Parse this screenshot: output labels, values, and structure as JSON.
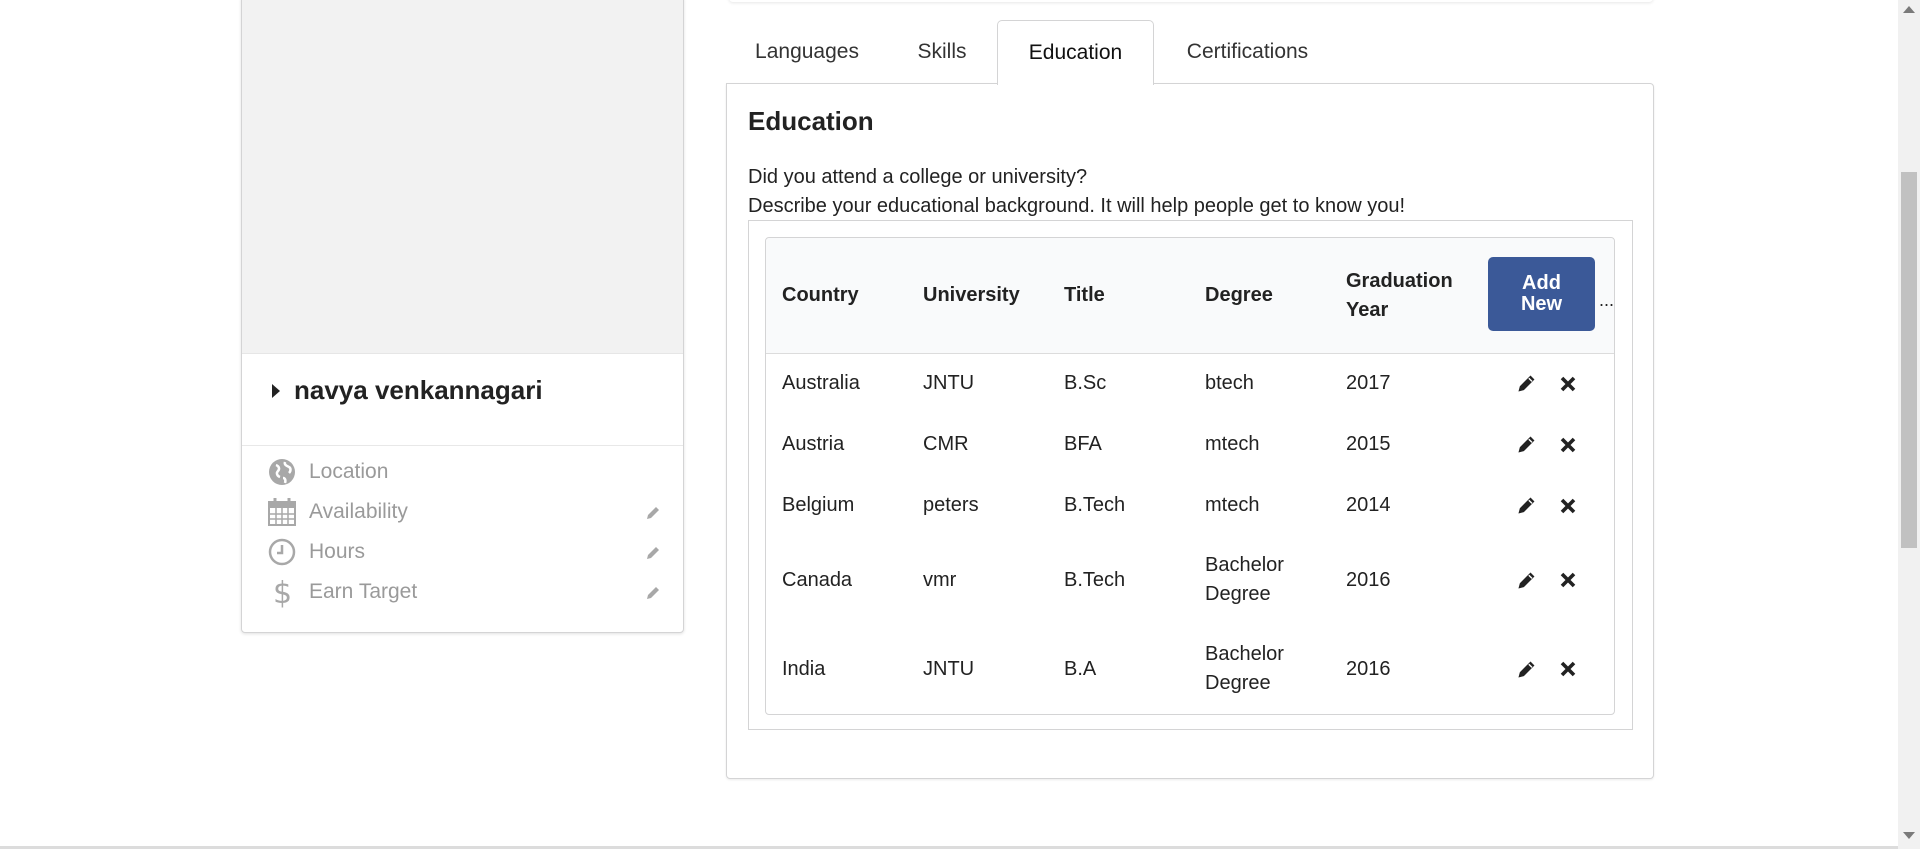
{
  "profile": {
    "name": "navya venkannagari",
    "meta": [
      {
        "label": "Location",
        "icon": "globe-icon",
        "editable": false
      },
      {
        "label": "Availability",
        "icon": "calendar-icon",
        "editable": true
      },
      {
        "label": "Hours",
        "icon": "clock-icon",
        "editable": true
      },
      {
        "label": "Earn Target",
        "icon": "dollar-icon",
        "editable": true
      }
    ]
  },
  "tabs": [
    {
      "label": "Languages",
      "active": false
    },
    {
      "label": "Skills",
      "active": false
    },
    {
      "label": "Education",
      "active": true
    },
    {
      "label": "Certifications",
      "active": false
    }
  ],
  "education": {
    "title": "Education",
    "description_line1": "Did you attend a college or university?",
    "description_line2": "Describe your educational background. It will help people get to know you!",
    "columns": [
      "Country",
      "University",
      "Title",
      "Degree",
      "Graduation\nYear"
    ],
    "add_new_label": "Add\nNew",
    "more_label": "...",
    "rows": [
      {
        "country": "Australia",
        "university": "JNTU",
        "title": "B.Sc",
        "degree": "btech",
        "year": "2017"
      },
      {
        "country": "Austria",
        "university": "CMR",
        "title": "BFA",
        "degree": "mtech",
        "year": "2015"
      },
      {
        "country": "Belgium",
        "university": "peters",
        "title": "B.Tech",
        "degree": "mtech",
        "year": "2014"
      },
      {
        "country": "Canada",
        "university": "vmr",
        "title": "B.Tech",
        "degree": "Bachelor\nDegree",
        "year": "2016"
      },
      {
        "country": "India",
        "university": "JNTU",
        "title": "B.A",
        "degree": "Bachelor\nDegree",
        "year": "2016"
      }
    ]
  },
  "colors": {
    "accent": "#3b5998",
    "muted_text": "#9a9a9a",
    "photo_placeholder": "#f2f2f2"
  }
}
